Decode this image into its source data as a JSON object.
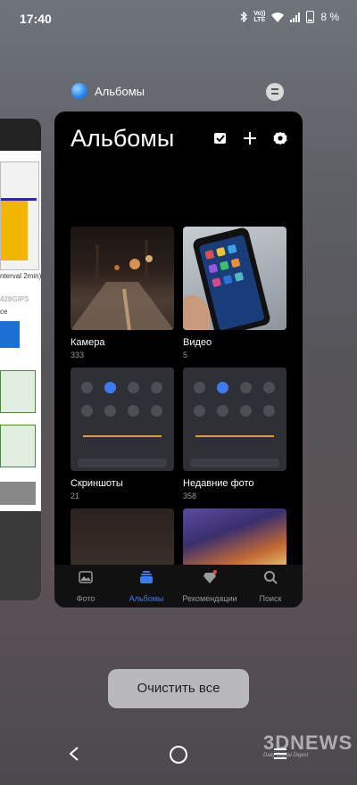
{
  "status_bar": {
    "time": "17:40",
    "volte_top": "Vo))",
    "volte_bottom": "LTE",
    "battery": "8 %"
  },
  "background_app": {
    "text_interval": "nterval 2min)",
    "text_gips": "428GIPS",
    "text_ce": "ce"
  },
  "app_label": {
    "name": "Альбомы"
  },
  "card": {
    "title": "Альбомы",
    "albums": [
      {
        "name": "Камера",
        "count": "333"
      },
      {
        "name": "Видео",
        "count": "5"
      },
      {
        "name": "Скриншоты",
        "count": "21"
      },
      {
        "name": "Недавние фото",
        "count": "358"
      }
    ],
    "bottom_nav": [
      {
        "label": "Фото",
        "icon": "photo-icon"
      },
      {
        "label": "Альбомы",
        "icon": "albums-icon"
      },
      {
        "label": "Рекомендации",
        "icon": "recommendations-icon"
      },
      {
        "label": "Поиск",
        "icon": "search-icon"
      }
    ]
  },
  "clear_all": {
    "label": "Очистить все"
  },
  "watermark": {
    "title": "3DNEWS",
    "subtitle": "Daily Digital Digest"
  },
  "colors": {
    "accent": "#3d7cf0",
    "card_bg": "#000000",
    "clear_bg": "#b9b9bb"
  }
}
